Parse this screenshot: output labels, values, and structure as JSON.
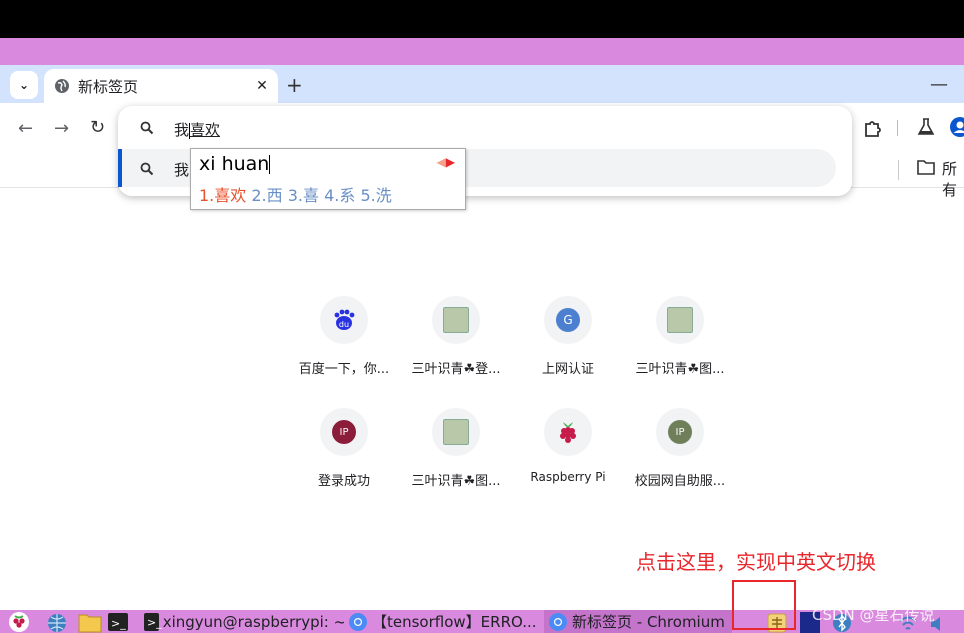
{
  "browser": {
    "tab": {
      "title": "新标签页",
      "close": "✕"
    },
    "newtab": "+",
    "minimize": "—",
    "tab_dropdown": "⌄",
    "toolbar": {
      "back": "←",
      "forward": "→",
      "reload": "↻"
    },
    "bookmarks": {
      "folder_label": "所有"
    }
  },
  "omnibox": {
    "query_prefix": "我",
    "query_composition": "喜欢",
    "suggestion_text": "我"
  },
  "ime": {
    "preedit": "xi huan",
    "candidates": [
      {
        "label": "1.喜欢",
        "selected": true
      },
      {
        "label": "2.西"
      },
      {
        "label": "3.喜"
      },
      {
        "label": "4.系"
      },
      {
        "label": "5.洗"
      }
    ]
  },
  "shortcuts": [
    {
      "label": "百度一下，你...",
      "icon": "baidu-icon",
      "icon_text": "du"
    },
    {
      "label": "三叶识青☘登...",
      "icon": "thumbnail-icon"
    },
    {
      "label": "上网认证",
      "icon": "letter-g-icon",
      "icon_text": "G"
    },
    {
      "label": "三叶识青☘图...",
      "icon": "thumbnail-icon"
    },
    {
      "label": "登录成功",
      "icon": "ip-icon",
      "icon_text": "IP",
      "color": "#8b1c3a"
    },
    {
      "label": "三叶识青☘图...",
      "icon": "thumbnail-icon"
    },
    {
      "label": "Raspberry Pi",
      "icon": "raspberry-icon"
    },
    {
      "label": "校园网自助服...",
      "icon": "ip-icon",
      "icon_text": "IP",
      "color": "#6f7f5a"
    }
  ],
  "annotation": {
    "text": "点击这里，实现中英文切换"
  },
  "taskbar": {
    "terminal_label": "xingyun@raspberrypi: ~",
    "chromium_item_1": "【tensorflow】ERRO...",
    "chromium_item_2": "新标签页 - Chromium"
  },
  "watermark": "CSDN @星石传说",
  "colors": {
    "accent": "#0b57d0",
    "taskbar": "#d98ade",
    "annotation": "#e8262b"
  }
}
